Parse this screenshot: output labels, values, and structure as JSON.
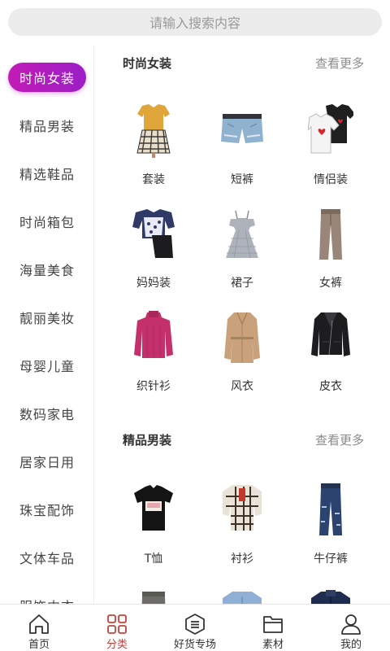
{
  "search": {
    "placeholder": "请输入搜索内容"
  },
  "sidebar": {
    "items": [
      {
        "label": "时尚女装",
        "active": true
      },
      {
        "label": "精品男装"
      },
      {
        "label": "精选鞋品"
      },
      {
        "label": "时尚箱包"
      },
      {
        "label": "海量美食"
      },
      {
        "label": "靓丽美妆"
      },
      {
        "label": "母婴儿童"
      },
      {
        "label": "数码家电"
      },
      {
        "label": "居家日用"
      },
      {
        "label": "珠宝配饰"
      },
      {
        "label": "文体车品"
      },
      {
        "label": "服饰内衣"
      }
    ]
  },
  "sections": [
    {
      "title": "时尚女装",
      "more": "查看更多",
      "items": [
        {
          "label": "套装",
          "icon": "outfit-icon"
        },
        {
          "label": "短裤",
          "icon": "shorts-icon"
        },
        {
          "label": "情侣装",
          "icon": "couple-shirts-icon"
        },
        {
          "label": "妈妈装",
          "icon": "mom-outfit-icon"
        },
        {
          "label": "裙子",
          "icon": "dress-icon"
        },
        {
          "label": "女裤",
          "icon": "trousers-icon"
        },
        {
          "label": "织针衫",
          "icon": "sweater-icon"
        },
        {
          "label": "风衣",
          "icon": "trench-coat-icon"
        },
        {
          "label": "皮衣",
          "icon": "leather-jacket-icon"
        }
      ]
    },
    {
      "title": "精品男装",
      "more": "查看更多",
      "items": [
        {
          "label": "T恤",
          "icon": "tshirt-icon"
        },
        {
          "label": "衬衫",
          "icon": "plaid-shirt-icon"
        },
        {
          "label": "牛仔裤",
          "icon": "jeans-icon"
        },
        {
          "label": "",
          "icon": "cargo-pants-icon"
        },
        {
          "label": "",
          "icon": "denim-jacket-icon"
        },
        {
          "label": "",
          "icon": "puffer-jacket-icon"
        }
      ]
    }
  ],
  "tabbar": {
    "tabs": [
      {
        "label": "首页",
        "icon": "home-icon"
      },
      {
        "label": "分类",
        "icon": "category-grid-icon",
        "active": true
      },
      {
        "label": "好货专场",
        "icon": "menu-hexagon-icon"
      },
      {
        "label": "素材",
        "icon": "folder-icon"
      },
      {
        "label": "我的",
        "icon": "user-icon"
      }
    ]
  },
  "colors": {
    "accent_gradient_start": "#c21bb6",
    "accent_gradient_end": "#9b1fc6",
    "tab_active": "#c9403a"
  }
}
